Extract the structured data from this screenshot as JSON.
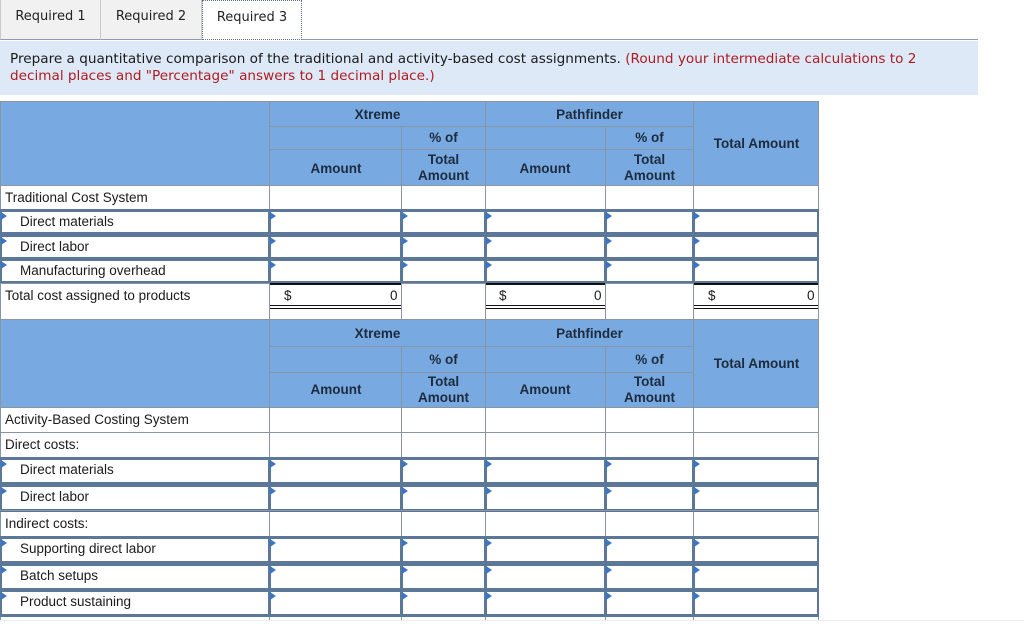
{
  "tabs": [
    {
      "label": "Required 1",
      "active": false
    },
    {
      "label": "Required 2",
      "active": false
    },
    {
      "label": "Required 3",
      "active": true
    }
  ],
  "instructions": {
    "text": "Prepare a quantitative comparison of the traditional and activity-based cost assignments.",
    "note": "(Round your intermediate calculations to 2 decimal places and \"Percentage\" answers to 1 decimal place.)"
  },
  "colors": {
    "header_bg": "#78aae1",
    "instructions_bg": "#dde9f6",
    "note_text": "#b01b22",
    "input_border": "#5c7899",
    "input_marker": "#3b76c4"
  },
  "table_headers": {
    "product1": "Xtreme",
    "product2": "Pathfinder",
    "amount": "Amount",
    "pct_line1": "% of",
    "pct_line2": "Total",
    "pct_line3": "Amount",
    "total_amount": "Total Amount"
  },
  "traditional": {
    "section_label": "Traditional Cost System",
    "rows": [
      {
        "label": "Direct materials",
        "xtreme_amount": "",
        "xtreme_pct": "",
        "pathfinder_amount": "",
        "pathfinder_pct": "",
        "total": ""
      },
      {
        "label": "Direct labor",
        "xtreme_amount": "",
        "xtreme_pct": "",
        "pathfinder_amount": "",
        "pathfinder_pct": "",
        "total": ""
      },
      {
        "label": "Manufacturing overhead",
        "xtreme_amount": "",
        "xtreme_pct": "",
        "pathfinder_amount": "",
        "pathfinder_pct": "",
        "total": ""
      }
    ],
    "total_row": {
      "label": "Total cost assigned to products",
      "currency": "$",
      "xtreme_amount": "0",
      "pathfinder_amount": "0",
      "total": "0"
    }
  },
  "abc": {
    "section_label": "Activity-Based Costing System",
    "direct_label": "Direct costs:",
    "direct_rows": [
      {
        "label": "Direct materials",
        "xtreme_amount": "",
        "xtreme_pct": "",
        "pathfinder_amount": "",
        "pathfinder_pct": "",
        "total": ""
      },
      {
        "label": "Direct labor",
        "xtreme_amount": "",
        "xtreme_pct": "",
        "pathfinder_amount": "",
        "pathfinder_pct": "",
        "total": ""
      }
    ],
    "indirect_label": "Indirect costs:",
    "indirect_rows": [
      {
        "label": "Supporting direct labor",
        "xtreme_amount": "",
        "xtreme_pct": "",
        "pathfinder_amount": "",
        "pathfinder_pct": "",
        "total": ""
      },
      {
        "label": "Batch setups",
        "xtreme_amount": "",
        "xtreme_pct": "",
        "pathfinder_amount": "",
        "pathfinder_pct": "",
        "total": ""
      },
      {
        "label": "Product sustaining",
        "xtreme_amount": "",
        "xtreme_pct": "",
        "pathfinder_amount": "",
        "pathfinder_pct": "",
        "total": ""
      }
    ]
  }
}
